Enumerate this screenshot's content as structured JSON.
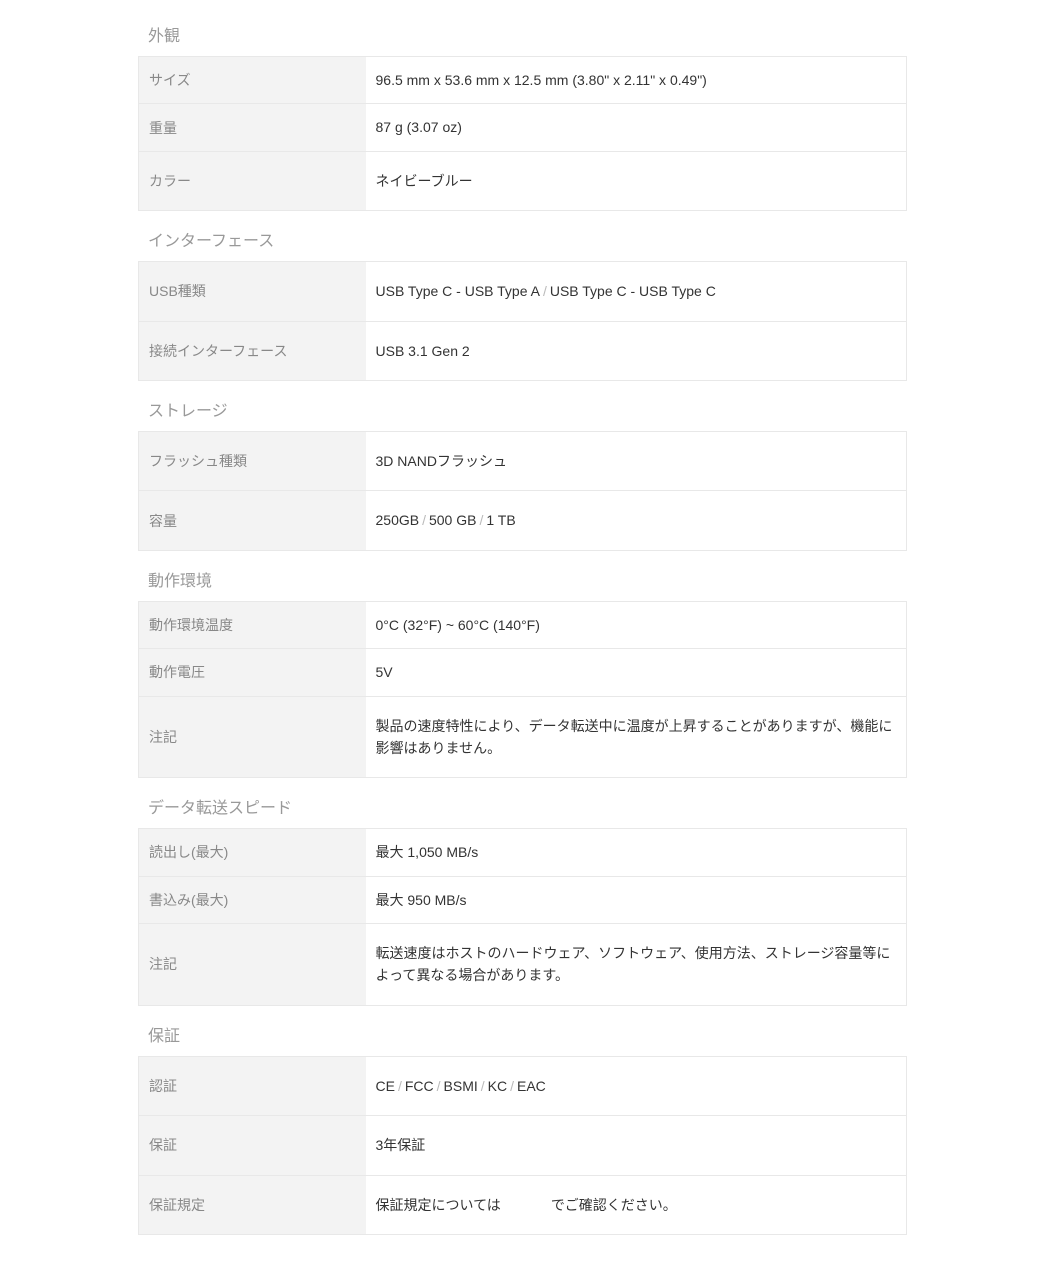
{
  "sections": [
    {
      "title": "外観",
      "rows": [
        {
          "label": "サイズ",
          "value": "96.5 mm x 53.6 mm x 12.5 mm (3.80\" x 2.11\" x 0.49\")"
        },
        {
          "label": "重量",
          "value": "87 g (3.07 oz)"
        },
        {
          "label": "カラー",
          "value": "ネイビーブルー",
          "tall": true
        }
      ]
    },
    {
      "title": "インターフェース",
      "rows": [
        {
          "label": "USB種類",
          "values": [
            "USB Type C - USB Type A",
            "USB Type C - USB Type C"
          ],
          "tall": true
        },
        {
          "label": "接続インターフェース",
          "value": "USB 3.1 Gen 2",
          "tall": true
        }
      ]
    },
    {
      "title": "ストレージ",
      "rows": [
        {
          "label": "フラッシュ種類",
          "value": "3D NANDフラッシュ",
          "tall": true
        },
        {
          "label": "容量",
          "values": [
            "250GB",
            "500 GB",
            "1 TB"
          ],
          "tall": true
        }
      ]
    },
    {
      "title": "動作環境",
      "rows": [
        {
          "label": "動作環境温度",
          "value": "0°C (32°F) ~ 60°C (140°F)"
        },
        {
          "label": "動作電圧",
          "value": "5V"
        },
        {
          "label": "注記",
          "value": "製品の速度特性により、データ転送中に温度が上昇することがありますが、機能に影響はありません。",
          "tall": true
        }
      ]
    },
    {
      "title": "データ転送スピード",
      "rows": [
        {
          "label": "読出し(最大)",
          "value": "最大 1,050 MB/s"
        },
        {
          "label": "書込み(最大)",
          "value": "最大 950 MB/s"
        },
        {
          "label": "注記",
          "value": "転送速度はホストのハードウェア、ソフトウェア、使用方法、ストレージ容量等によって異なる場合があります。",
          "tall": true
        }
      ]
    },
    {
      "title": "保証",
      "rows": [
        {
          "label": "認証",
          "values": [
            "CE",
            "FCC",
            "BSMI",
            "KC",
            "EAC"
          ],
          "tall": true
        },
        {
          "label": "保証",
          "value": "3年保証",
          "tall": true
        },
        {
          "label": "保証規定",
          "value_prefix": "保証規定については",
          "value_suffix": "でご確認ください。",
          "link_gap": true,
          "tall": true
        }
      ]
    }
  ]
}
